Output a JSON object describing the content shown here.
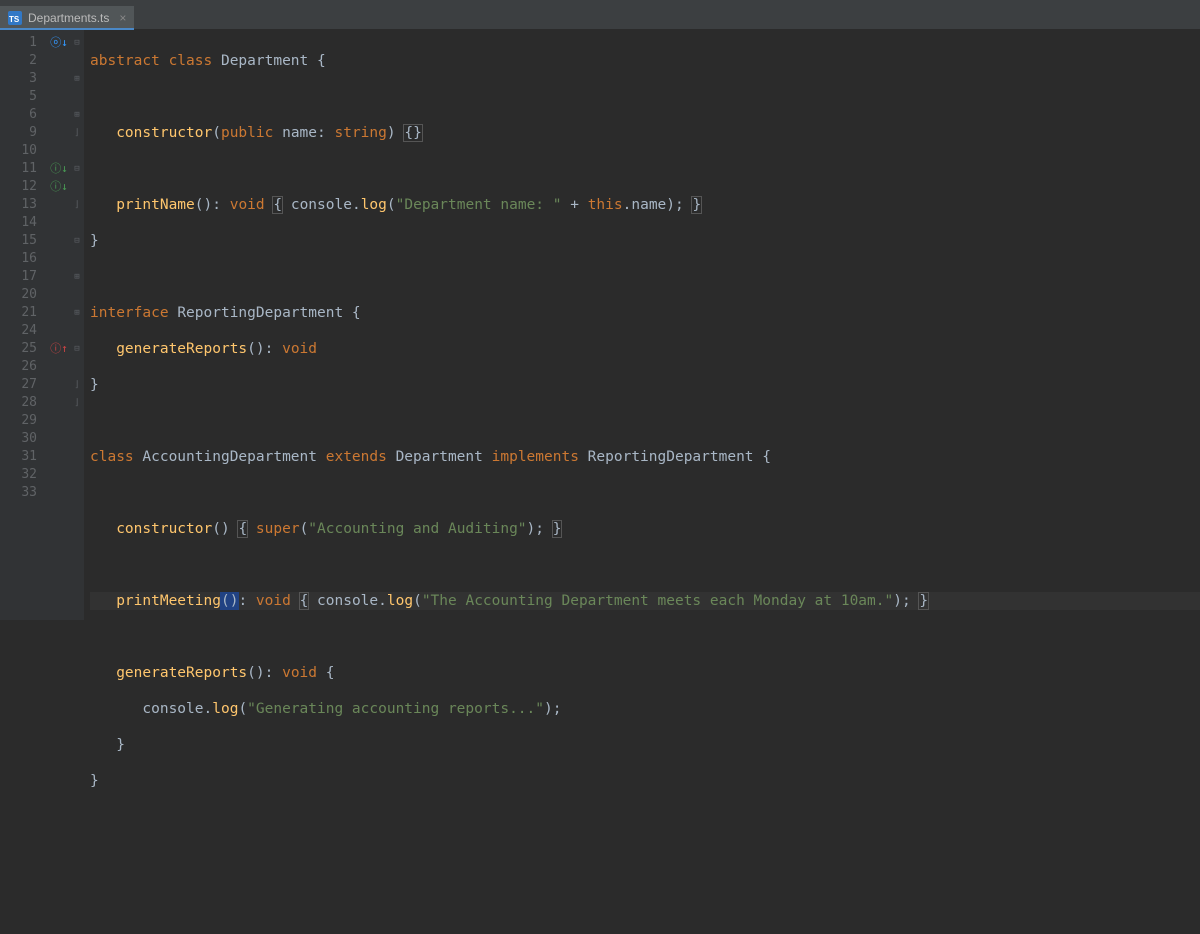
{
  "tab": {
    "filename": "Departments.ts",
    "icon_label": "TS"
  },
  "line_numbers": [
    1,
    2,
    3,
    5,
    6,
    9,
    10,
    11,
    12,
    13,
    14,
    15,
    16,
    17,
    20,
    21,
    24,
    25,
    26,
    27,
    28,
    29,
    30,
    31,
    32,
    33
  ],
  "gutter_marks": {
    "1": "override-down",
    "11": "impl-down",
    "12": "impl-down",
    "25": "impl-up"
  },
  "fold_marks": {
    "1": "open",
    "3": "collapsed",
    "6": "collapsed",
    "9": "close",
    "11": "open",
    "13": "close",
    "15": "open",
    "17": "collapsed",
    "21": "collapsed",
    "25": "open",
    "27": "close",
    "28": "close"
  },
  "code": {
    "l1": {
      "kw_abstract": "abstract",
      "kw_class": "class",
      "name": "Department",
      "brace": "{"
    },
    "l3": {
      "fn": "constructor",
      "paren_open": "(",
      "kw_public": "public",
      "param": "name",
      "colon": ":",
      "type": "string",
      "paren_close": ")",
      "body": "{}"
    },
    "l6": {
      "fn": "printName",
      "paren": "()",
      "colon": ":",
      "type": "void",
      "brace_open": "{",
      "console": "console",
      "dot": ".",
      "log": "log",
      "p_open": "(",
      "str": "\"Department name: \"",
      "plus": " + ",
      "this": "this",
      "dot2": ".",
      "name": "name",
      "p_close": ")",
      "semi": ";",
      "brace_close": "}"
    },
    "l9": {
      "brace": "}"
    },
    "l11": {
      "kw": "interface",
      "name": "ReportingDepartment",
      "brace": "{"
    },
    "l12": {
      "fn": "generateReports",
      "paren": "()",
      "colon": ":",
      "type": "void"
    },
    "l13": {
      "brace": "}"
    },
    "l15": {
      "kw_class": "class",
      "name": "AccountingDepartment",
      "kw_extends": "extends",
      "base": "Department",
      "kw_impl": "implements",
      "iface": "ReportingDepartment",
      "brace": "{"
    },
    "l17": {
      "fn": "constructor",
      "paren": "()",
      "brace_open": "{",
      "super": "super",
      "p_open": "(",
      "str": "\"Accounting and Auditing\"",
      "p_close": ")",
      "semi": ";",
      "brace_close": "}"
    },
    "l21": {
      "fn": "printMeeting",
      "paren": "()",
      "colon": ":",
      "type": "void",
      "brace_open": "{",
      "console": "console",
      "dot": ".",
      "log": "log",
      "p_open": "(",
      "str": "\"The Accounting Department meets each Monday at 10am.\"",
      "p_close": ")",
      "semi": ";",
      "brace_close": "}"
    },
    "l25": {
      "fn": "generateReports",
      "paren": "()",
      "colon": ":",
      "type": "void",
      "brace": "{"
    },
    "l26": {
      "console": "console",
      "dot": ".",
      "log": "log",
      "p_open": "(",
      "str": "\"Generating accounting reports...\"",
      "p_close": ")",
      "semi": ";"
    },
    "l27": {
      "brace": "}"
    },
    "l28": {
      "brace": "}"
    }
  }
}
